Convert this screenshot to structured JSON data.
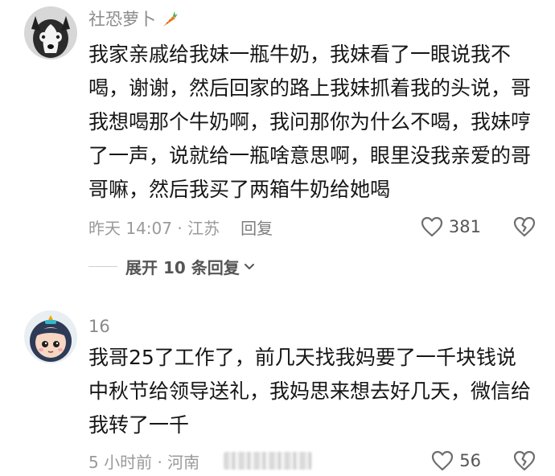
{
  "comments": [
    {
      "username": "社恐萝卜",
      "badge_icon": "carrot-icon",
      "avatar_icon": "husky-dog-avatar",
      "text": "我家亲戚给我妹一瓶牛奶，我妹看了一眼说我不喝，谢谢，然后回家的路上我妹抓着我的头说，哥我想喝那个牛奶啊，我问那你为什么不喝，我妹哼了一声，说就给一瓶啥意思啊，眼里没我亲爱的哥哥嘛，然后我买了两箱牛奶给她喝",
      "time_location": "昨天 14:07 · 江苏",
      "reply_label": "回复",
      "like_count": "381",
      "expand_label": "展开 10 条回复"
    },
    {
      "username": "16",
      "avatar_icon": "cartoon-girl-avatar",
      "text": "我哥25了工作了，前几天找我妈要了一千块钱说中秋节给领导送礼，我妈思来想去好几天，微信给我转了一千",
      "time_location": "5 小时前 · 河南",
      "like_count": "56"
    }
  ],
  "colors": {
    "text_primary": "#161616",
    "text_secondary": "#9a9a9a",
    "icon_gray": "#6e6e6e",
    "carrot_orange": "#f07c1e"
  }
}
